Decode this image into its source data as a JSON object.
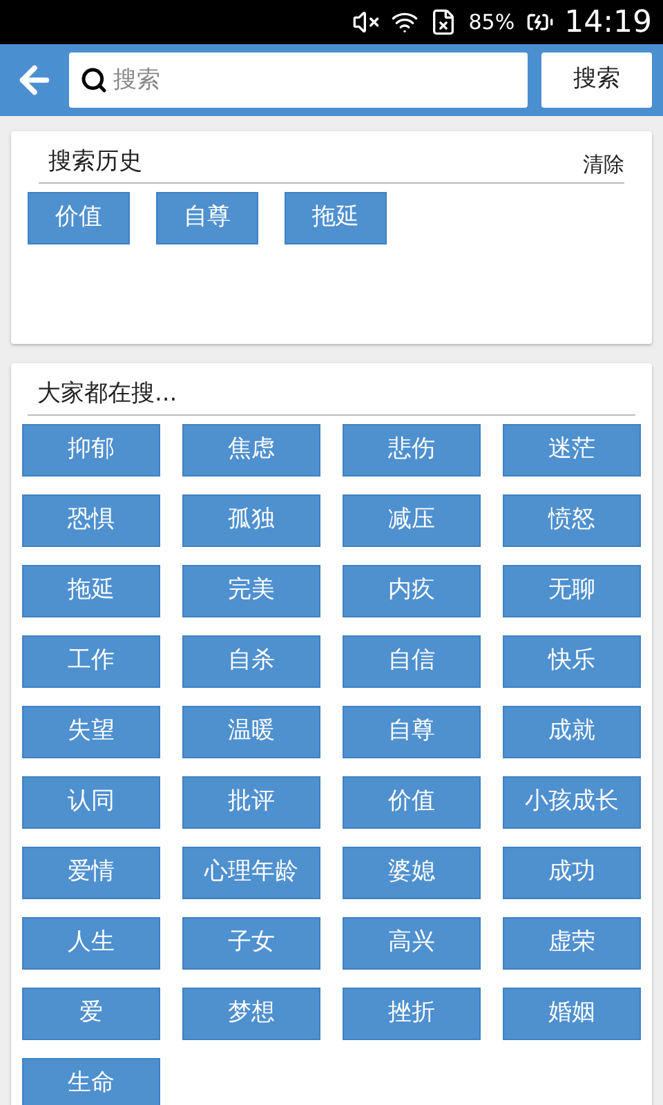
{
  "status_bar": {
    "battery": "85%",
    "time": "14:19"
  },
  "search": {
    "placeholder": "搜索",
    "button": "搜索"
  },
  "history": {
    "title": "搜索历史",
    "clear": "清除",
    "items": [
      "价值",
      "自尊",
      "拖延"
    ]
  },
  "popular": {
    "title": "大家都在搜...",
    "items": [
      "抑郁",
      "焦虑",
      "悲伤",
      "迷茫",
      "恐惧",
      "孤独",
      "减压",
      "愤怒",
      "拖延",
      "完美",
      "内疚",
      "无聊",
      "工作",
      "自杀",
      "自信",
      "快乐",
      "失望",
      "温暖",
      "自尊",
      "成就",
      "认同",
      "批评",
      "价值",
      "小孩成长",
      "爱情",
      "心理年龄",
      "婆媳",
      "成功",
      "人生",
      "子女",
      "高兴",
      "虚荣",
      "爱",
      "梦想",
      "挫折",
      "婚姻",
      "生命"
    ]
  }
}
